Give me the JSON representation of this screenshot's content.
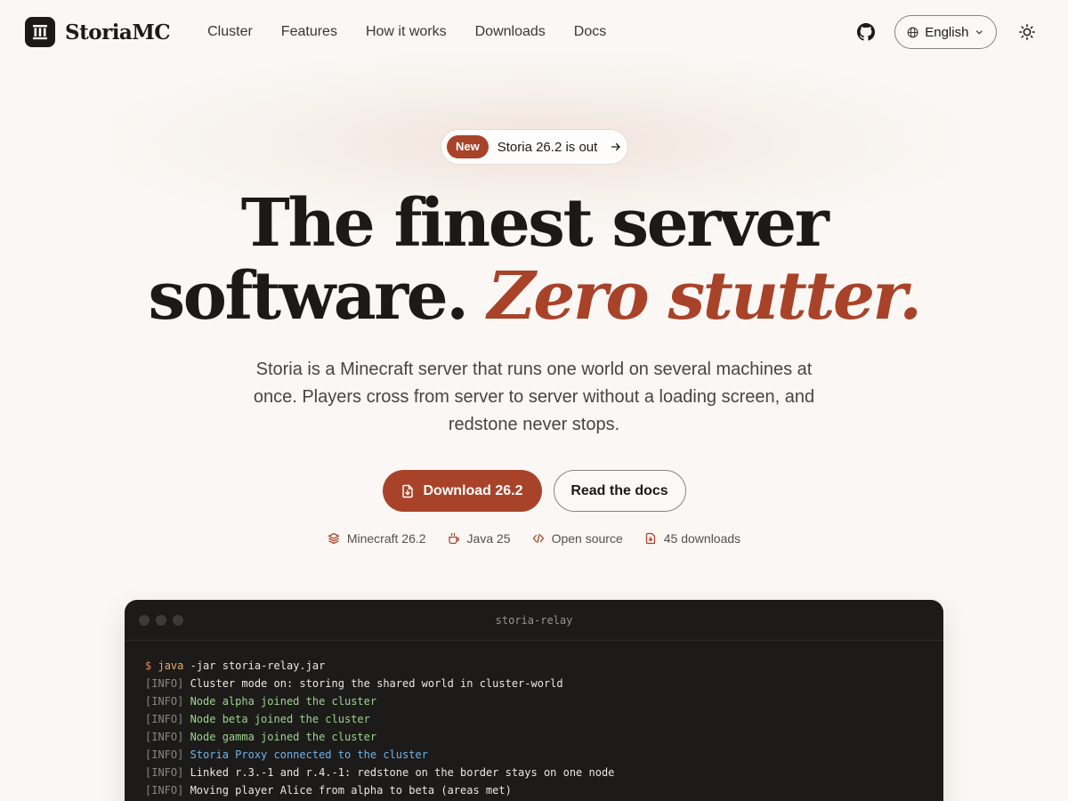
{
  "header": {
    "brand": "StoriaMC",
    "nav": [
      "Cluster",
      "Features",
      "How it works",
      "Downloads",
      "Docs"
    ],
    "language": "English",
    "icons": {
      "github": "github-icon",
      "globe": "globe-icon",
      "theme": "sun-icon"
    }
  },
  "hero": {
    "badge_new": "New",
    "badge_text": "Storia 26.2 is out",
    "title_line1": "The finest server",
    "title_line2_plain": "software.",
    "title_line2_accent": "Zero stutter.",
    "subtitle": "Storia is a Minecraft server that runs one world on several machines at once. Players cross from server to server without a loading screen, and redstone never stops.",
    "primary_cta": "Download 26.2",
    "secondary_cta": "Read the docs",
    "meta": [
      "Minecraft 26.2",
      "Java 25",
      "Open source",
      "45 downloads"
    ]
  },
  "terminal": {
    "title": "storia-relay",
    "prompt": "$",
    "command": "java",
    "args": " -jar storia-relay.jar",
    "tag": "[INFO]",
    "lines": [
      {
        "text": "Cluster mode on: storing the shared world in cluster-world",
        "tone": "white"
      },
      {
        "text": "Node alpha joined the cluster",
        "tone": "green"
      },
      {
        "text": "Node beta joined the cluster",
        "tone": "green"
      },
      {
        "text": "Node gamma joined the cluster",
        "tone": "green"
      },
      {
        "text": "Storia Proxy connected to the cluster",
        "tone": "blue"
      },
      {
        "text": "Linked r.3.-1 and r.4.-1: redstone on the border stays on one node",
        "tone": "white"
      },
      {
        "text": "Moving player Alice from alpha to beta (areas met)",
        "tone": "white"
      }
    ]
  },
  "colors": {
    "accent": "#a8432a",
    "background": "#faf7f4",
    "text": "#1c1917",
    "terminal_bg": "#1c1b1a",
    "log_green": "#9bd48a",
    "log_blue": "#6fb2e8"
  }
}
